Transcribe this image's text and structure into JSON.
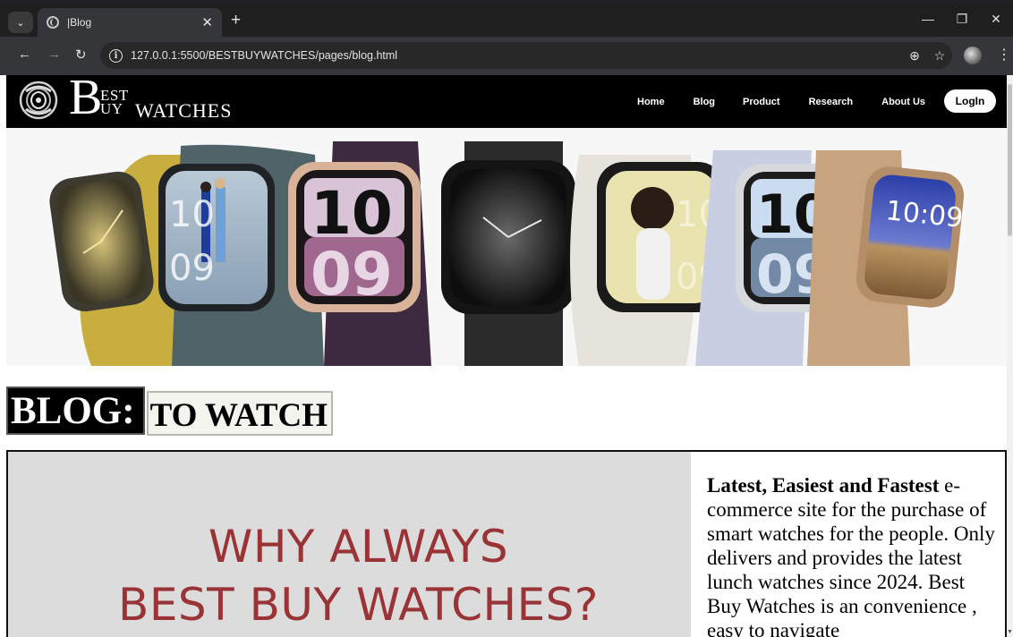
{
  "browser": {
    "tab_title": "|Blog",
    "url": "127.0.0.1:5500/BESTBUYWATCHES/pages/blog.html",
    "icons": {
      "tab_menu": "chevron-down-icon",
      "new_tab": "plus-icon",
      "back": "arrow-left-icon",
      "forward": "arrow-right-icon",
      "reload": "reload-icon",
      "site_info": "info-icon",
      "zoom": "zoom-icon",
      "bookmark": "star-icon",
      "profile": "avatar",
      "menu": "kebab-menu-icon",
      "minimize": "minimize-icon",
      "restore": "restore-icon",
      "close": "close-icon"
    },
    "glyphs": {
      "tab_menu": "⌄",
      "tab_close": "✕",
      "new_tab": "+",
      "back": "←",
      "forward": "→",
      "reload": "↻",
      "info": "i",
      "zoom": "⊕",
      "star": "☆",
      "kebab": "⋮",
      "minimize": "—",
      "restore": "❐",
      "close": "✕"
    }
  },
  "site": {
    "logo": {
      "big_letter": "B",
      "line1": "EST",
      "line2": "UY",
      "watches": "WATCHES"
    },
    "nav": [
      "Home",
      "Blog",
      "Product",
      "Research",
      "About Us"
    ],
    "login_label": "LogIn"
  },
  "blog_heading": {
    "label": "BLOG:",
    "subtitle": "TO WATCH"
  },
  "why_panel": {
    "line1": "WHY ALWAYS",
    "line2": "BEST BUY WATCHES?"
  },
  "about": {
    "bold": "Latest, Easiest and Fastest",
    "text": " e-commerce site for the purchase of smart watches for the people. Only delivers and provides the latest lunch watches since 2024. Best Buy Watches is an convenience , easy to navigate"
  },
  "hero": {
    "watches": [
      {
        "name": "gold-loop-watch",
        "band": "#c7ae3f",
        "case": "#3d3b30",
        "face": "gold-radial"
      },
      {
        "name": "slate-sport-watch",
        "band": "#4f6368",
        "case": "#2a2d2f",
        "face": "photo-couple"
      },
      {
        "name": "plum-link-watch",
        "band": "#3e2a3e",
        "case": "#d8b39a",
        "face": "pink-digits"
      },
      {
        "name": "black-milanese-watch",
        "band": "#2b2b2b",
        "case": "#1b1b1b",
        "face": "black-radial"
      },
      {
        "name": "white-sport-watch",
        "band": "#e6e3dd",
        "case": "#1a1a1a",
        "face": "photo-portrait"
      },
      {
        "name": "lavender-loop-watch",
        "band": "#c9cfe2",
        "case": "#d7d9dc",
        "face": "blue-digits"
      },
      {
        "name": "gold-link-watch",
        "band": "#c7a37f",
        "case": "#b38e68",
        "face": "photo-landscape"
      }
    ],
    "digit_text": {
      "top": "10",
      "bottom": "09",
      "clock": "10:09"
    }
  },
  "colors": {
    "why_text": "#9a3336",
    "header_bg": "#000000",
    "panel_bg": "#dcdcdc"
  }
}
